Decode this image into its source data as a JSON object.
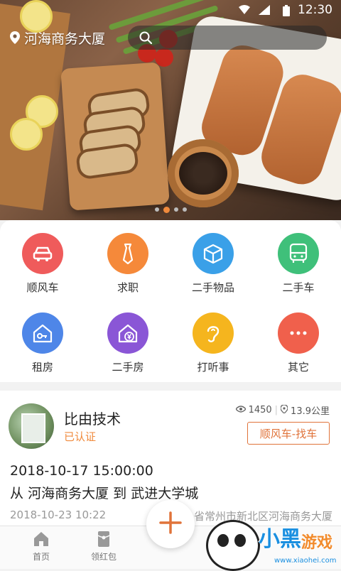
{
  "status_bar": {
    "time": "12:30",
    "signal_icon": "signal-icon",
    "wifi_icon": "wifi-icon",
    "battery_icon": "battery-icon"
  },
  "header": {
    "location": "河海商务大厦",
    "location_icon": "location-pin-icon",
    "search_icon": "search-icon"
  },
  "carousel": {
    "page_count": 4,
    "active_index": 1
  },
  "categories": [
    {
      "label": "顺风车",
      "icon": "car-icon",
      "color": "#ef5b5b"
    },
    {
      "label": "求职",
      "icon": "tie-icon",
      "color": "#f5893a"
    },
    {
      "label": "二手物品",
      "icon": "box-icon",
      "color": "#3aa0e8"
    },
    {
      "label": "二手车",
      "icon": "bus-icon",
      "color": "#3fc07a"
    },
    {
      "label": "租房",
      "icon": "house-key-icon",
      "color": "#4e86e8"
    },
    {
      "label": "二手房",
      "icon": "house-yen-icon",
      "color": "#8a56d6"
    },
    {
      "label": "打听事",
      "icon": "ear-icon",
      "color": "#f5b51e"
    },
    {
      "label": "其它",
      "icon": "more-icon",
      "color": "#f0604c"
    }
  ],
  "post": {
    "username": "比由技术",
    "verified": "已认证",
    "views": "1450",
    "distance": "13.9公里",
    "tag": "顺风车-找车",
    "datetime": "2018-10-17 15:00:00",
    "route_from_prefix": "从",
    "route_from": "河海商务大厦",
    "route_to_prefix": "到",
    "route_to": "武进大学城",
    "published": "2018-10-23 10:22",
    "address": "省常州市新北区河海商务大厦"
  },
  "tabs": [
    {
      "label": "首页",
      "icon": "home-icon"
    },
    {
      "label": "领红包",
      "icon": "red-envelope-icon"
    }
  ],
  "fab": {
    "icon": "plus-icon"
  },
  "watermark": {
    "brand": "小黑",
    "brand2": "游戏",
    "url": "www.xiaohei.com"
  }
}
